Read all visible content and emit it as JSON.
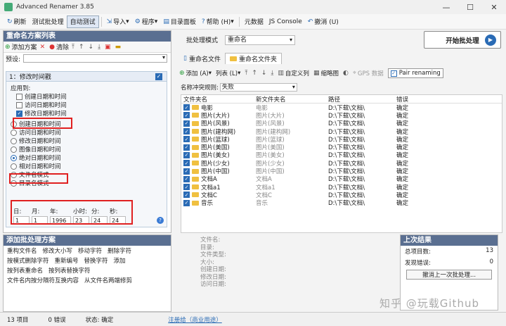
{
  "window": {
    "title": "Advanced Renamer 3.85"
  },
  "menu": [
    {
      "label": "刷新",
      "icon": "refresh-icon"
    },
    {
      "label": "测试批处理",
      "icon": ""
    },
    {
      "label": "自动测试",
      "icon": "",
      "active": true
    },
    {
      "label": "导入",
      "icon": "import-icon"
    },
    {
      "label": "程序",
      "icon": "program-icon"
    },
    {
      "label": "目录面板",
      "icon": "folder-panel-icon"
    },
    {
      "label": "帮助 (H)",
      "icon": "help-icon"
    },
    {
      "label": "元数据",
      "icon": ""
    },
    {
      "label": "JS Console",
      "icon": ""
    },
    {
      "label": "撤消 (U)",
      "icon": "undo-icon"
    }
  ],
  "left": {
    "title": "重命名方案列表",
    "add_method": "添加方案",
    "clear": "清除",
    "preset_label": "预设:"
  },
  "method": {
    "name": "1：修改时间戳",
    "apply_to": "应用到:",
    "checks": [
      {
        "label": "创建日期和时间",
        "on": false
      },
      {
        "label": "访问日期和时间",
        "on": false
      },
      {
        "label": "修改日期和时间",
        "on": true
      }
    ],
    "radios": [
      {
        "label": "创建日期和时间",
        "on": false
      },
      {
        "label": "访问日期和时间",
        "on": false
      },
      {
        "label": "修改日期和时间",
        "on": false
      },
      {
        "label": "图像日期和时间",
        "on": false
      },
      {
        "label": "绝对日期和时间",
        "on": true
      },
      {
        "label": "相对日期和时间",
        "on": false
      },
      {
        "label": "文件名模式",
        "on": false
      },
      {
        "label": "目录名模式",
        "on": false
      }
    ],
    "fields": [
      {
        "label": "日:",
        "value": "1"
      },
      {
        "label": "月:",
        "value": "1"
      },
      {
        "label": "年:",
        "value": "1996"
      },
      {
        "label": "小时:",
        "value": "23"
      },
      {
        "label": "分:",
        "value": "24"
      },
      {
        "label": "秒:",
        "value": "24"
      }
    ]
  },
  "addpanel": {
    "title": "添加批处理方案",
    "items": [
      "重构文件名",
      "修改大小写",
      "移动字符",
      "删除字符",
      "按模式删除字符",
      "重新编号",
      "替换字符",
      "添加",
      "按列表重命名",
      "按列表替换字符",
      "文件名内按分隔符互换内容",
      "从文件名两端修剪"
    ]
  },
  "batch": {
    "label": "批处理模式",
    "mode": "重命名",
    "start": "开始批处理"
  },
  "tabs": [
    "重命名文件",
    "重命名文件夹"
  ],
  "rtools": {
    "add": "添加 (A)",
    "list": "列表 (L)",
    "custom_col": "自定义列",
    "thumbnail": "缩略图",
    "gps": "GPS 数据",
    "pair": "Pair renaming"
  },
  "conflict": {
    "label": "名称冲突规则:",
    "value": "失败"
  },
  "table": {
    "headers": [
      "文件夹名",
      "新文件夹名",
      "路径",
      "错误"
    ],
    "rows": [
      [
        "电影",
        "电影",
        "D:\\下载\\文档\\",
        "确定"
      ],
      [
        "图片(大片)",
        "图片(大片)",
        "D:\\下载\\文档\\",
        "确定"
      ],
      [
        "图片(风景)",
        "图片(风景)",
        "D:\\下载\\文档\\",
        "确定"
      ],
      [
        "图片(建构网)",
        "图片(建构网)",
        "D:\\下载\\文档\\",
        "确定"
      ],
      [
        "图片(篮球)",
        "图片(篮球)",
        "D:\\下载\\文档\\",
        "确定"
      ],
      [
        "图片(美国)",
        "图片(美国)",
        "D:\\下载\\文档\\",
        "确定"
      ],
      [
        "图片(美女)",
        "图片(美女)",
        "D:\\下载\\文档\\",
        "确定"
      ],
      [
        "图片(少女)",
        "图片(少女)",
        "D:\\下载\\文档\\",
        "确定"
      ],
      [
        "图片(中国)",
        "图片(中国)",
        "D:\\下载\\文档\\",
        "确定"
      ],
      [
        "文档A",
        "文档A",
        "D:\\下载\\文档\\",
        "确定"
      ],
      [
        "文档a1",
        "文档a1",
        "D:\\下载\\文档\\",
        "确定"
      ],
      [
        "文档C",
        "文档C",
        "D:\\下载\\文档\\",
        "确定"
      ],
      [
        "音乐",
        "音乐",
        "D:\\下载\\文档\\",
        "确定"
      ]
    ]
  },
  "info": [
    "文件名:",
    "目录:",
    "文件类型:",
    "大小:",
    "创建日期:",
    "修改日期:",
    "访问日期:"
  ],
  "lastres": {
    "title": "上次结果",
    "total_label": "总项目数:",
    "total": "13",
    "errors_label": "发现错误:",
    "errors": "0",
    "undo": "撤消上一次批处理..."
  },
  "status": {
    "items": "13 项目",
    "errors": "0 错误",
    "state": "状态: 确定",
    "register": "注册给（商业用途）"
  },
  "watermark": "知乎 @玩载Github"
}
